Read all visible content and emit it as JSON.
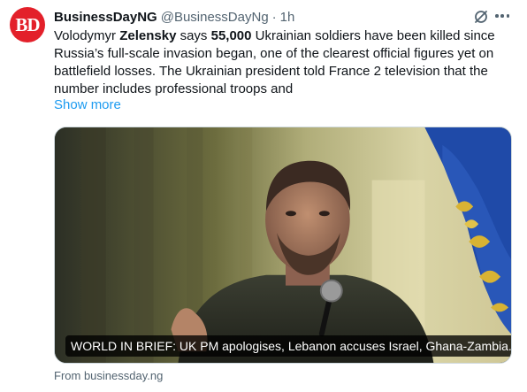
{
  "tweet": {
    "author_name": "BusinessDayNG",
    "avatar_text": "BD",
    "handle": "@BusinessDayNg",
    "separator": "·",
    "time": "1h",
    "text_parts": {
      "p1": "Volodymyr ",
      "p2": "Zelensky",
      "p3": " says ",
      "p4": "55,000",
      "p5": " Ukrainian soldiers have been killed since Russia’s full-scale invasion began, one of the clearest official figures yet on battlefield losses. The Ukrainian president told France 2 television that the number includes professional troops and"
    },
    "show_more_label": "Show more"
  },
  "card": {
    "caption": "WORLD IN BRIEF: UK PM apologises, Lebanon accuses Israel, Ghana-Zambia...",
    "source": "From businessday.ng"
  },
  "colors": {
    "brand_red": "#e3202a",
    "link_blue": "#1d9bf0",
    "muted_gray": "#536471",
    "flag_blue": "#1f4aa8",
    "flag_gold": "#d8b333"
  },
  "icons": {
    "grok": "grok-slash-icon",
    "more": "more-horizontal-icon"
  }
}
